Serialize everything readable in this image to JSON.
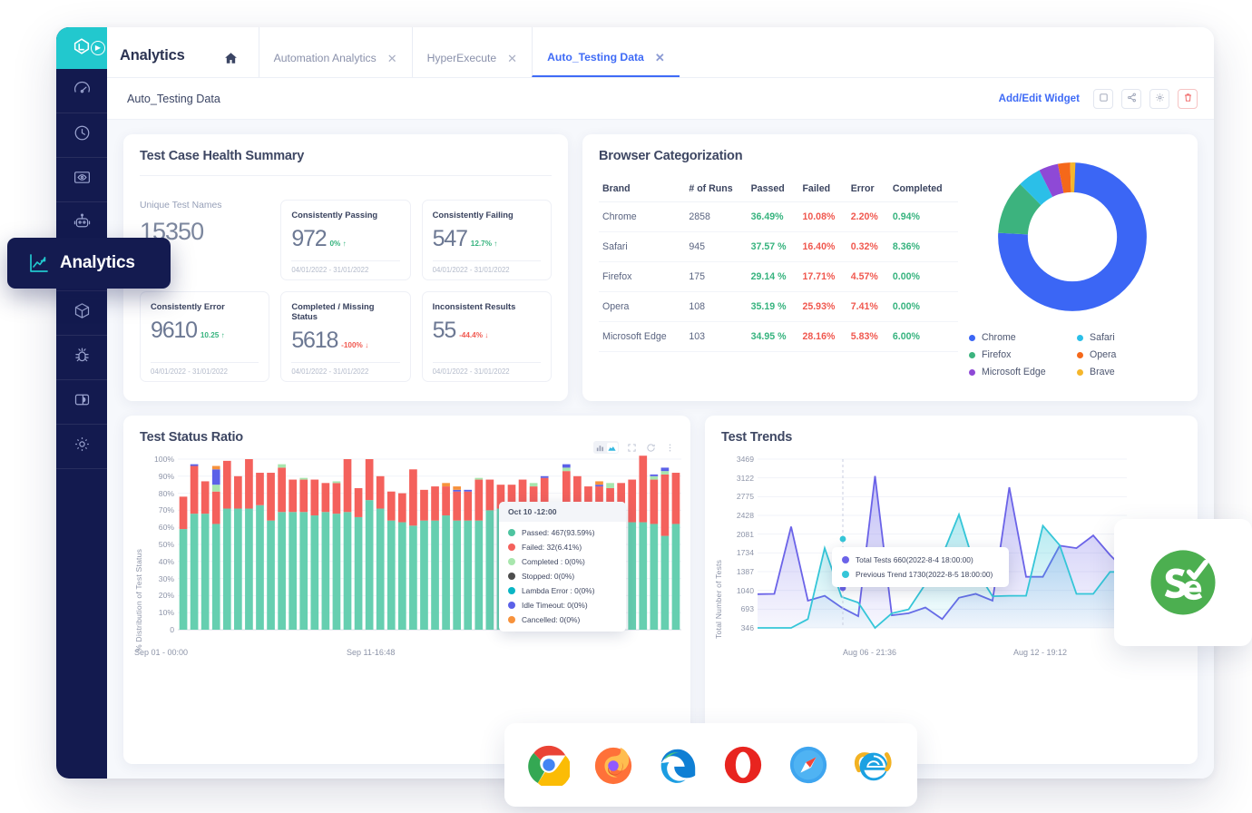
{
  "app": {
    "title": "Analytics",
    "home_icon": "home-icon",
    "logo_icon": "lambdatest-logo-icon",
    "expand_icon": "chevron-right-icon"
  },
  "sidebar": {
    "items": [
      {
        "name": "dashboard",
        "icon": "speedometer-icon"
      },
      {
        "name": "realtime",
        "icon": "clock-icon"
      },
      {
        "name": "screenshot",
        "icon": "monitor-eye-icon"
      },
      {
        "name": "automation",
        "icon": "robot-icon"
      },
      {
        "name": "analytics",
        "icon": "analytics-chart-icon"
      },
      {
        "name": "integrations",
        "icon": "box-icon"
      },
      {
        "name": "bugs",
        "icon": "bug-icon"
      },
      {
        "name": "docs",
        "icon": "book-contrast-icon"
      },
      {
        "name": "settings",
        "icon": "gear-icon"
      }
    ]
  },
  "tabs": [
    {
      "label": "Automation Analytics",
      "active": false,
      "close_icon": "close-icon"
    },
    {
      "label": "HyperExecute",
      "active": false,
      "close_icon": "close-icon"
    },
    {
      "label": "Auto_Testing Data",
      "active": true,
      "close_icon": "close-icon"
    }
  ],
  "subbar": {
    "breadcrumb": "Auto_Testing Data",
    "add_edit_widget": "Add/Edit Widget",
    "buttons": [
      {
        "name": "widget-layout-button",
        "icon": "square-icon"
      },
      {
        "name": "share-button",
        "icon": "share-icon"
      },
      {
        "name": "settings-button",
        "icon": "gear-icon"
      },
      {
        "name": "delete-button",
        "icon": "trash-icon"
      }
    ]
  },
  "health": {
    "title": "Test Case Health Summary",
    "unique": {
      "label": "Unique Test Names",
      "value": "15350"
    },
    "cards": [
      {
        "name": "Consistently Passing",
        "value": "972",
        "delta": "0%",
        "dir": "up",
        "range": "04/01/2022 - 31/01/2022"
      },
      {
        "name": "Consistently Failing",
        "value": "547",
        "delta": "12.7%",
        "dir": "up",
        "range": "04/01/2022 - 31/01/2022"
      },
      {
        "name": "Consistently Error",
        "value": "9610",
        "delta": "10.25",
        "dir": "up",
        "range": "04/01/2022 - 31/01/2022"
      },
      {
        "name": "Completed / Missing Status",
        "value": "5618",
        "delta": "-100%",
        "dir": "down",
        "range": "04/01/2022 - 31/01/2022"
      },
      {
        "name": "Inconsistent Results",
        "value": "55",
        "delta": "-44.4%",
        "dir": "down",
        "range": "04/01/2022 - 31/01/2022"
      }
    ]
  },
  "browser": {
    "title": "Browser Categorization",
    "columns": [
      "Brand",
      "# of Runs",
      "Passed",
      "Failed",
      "Error",
      "Completed"
    ],
    "rows": [
      {
        "brand": "Chrome",
        "runs": "2858",
        "passed": "36.49%",
        "failed": "10.08%",
        "error": "2.20%",
        "completed": "0.94%"
      },
      {
        "brand": "Safari",
        "runs": "945",
        "passed": "37.57 %",
        "failed": "16.40%",
        "error": "0.32%",
        "completed": "8.36%"
      },
      {
        "brand": "Firefox",
        "runs": "175",
        "passed": "29.14 %",
        "failed": "17.71%",
        "error": "4.57%",
        "completed": "0.00%"
      },
      {
        "brand": "Opera",
        "runs": "108",
        "passed": "35.19 %",
        "failed": "25.93%",
        "error": "7.41%",
        "completed": "0.00%"
      },
      {
        "brand": "Microsoft Edge",
        "runs": "103",
        "passed": "34.95 %",
        "failed": "28.16%",
        "error": "5.83%",
        "completed": "6.00%"
      }
    ],
    "legend": [
      {
        "label": "Chrome",
        "color": "#3b66f5"
      },
      {
        "label": "Safari",
        "color": "#2bbfe8"
      },
      {
        "label": "Firefox",
        "color": "#3cb37e"
      },
      {
        "label": "Opera",
        "color": "#f5681a"
      },
      {
        "label": "Microsoft Edge",
        "color": "#8e49d6"
      },
      {
        "label": "Brave",
        "color": "#f5b62b"
      }
    ]
  },
  "ratio": {
    "title": "Test Status Ratio",
    "toolbar": [
      "bar-chart-icon",
      "area-chart-icon",
      "fullscreen-icon",
      "reset-icon",
      "menu-icon"
    ],
    "ylabel": "% Distribution of Test Status",
    "yticks": [
      "100%",
      "90%",
      "80%",
      "70%",
      "60%",
      "50%",
      "40%",
      "30%",
      "20%",
      "10%",
      "0"
    ],
    "xticks": [
      "Sep 01 - 00:00",
      "Sep 11-16:48"
    ],
    "tooltip": {
      "title": "Oct 10 -12:00",
      "rows": [
        {
          "label": "Passed: 467(93.59%)",
          "color": "#4ec4a0"
        },
        {
          "label": "Failed: 32(6.41%)",
          "color": "#f4615c"
        },
        {
          "label": "Completed : 0(0%)",
          "color": "#a8e6ad"
        },
        {
          "label": "Stopped: 0(0%)",
          "color": "#4d4d4d"
        },
        {
          "label": "Lambda Error : 0(0%)",
          "color": "#0ab5c4"
        },
        {
          "label": "Idle Timeout: 0(0%)",
          "color": "#5b61e8"
        },
        {
          "label": "Cancelled: 0(0%)",
          "color": "#f7923c"
        }
      ]
    }
  },
  "trends": {
    "title": "Test Trends",
    "ylabel": "Total Number of Tests",
    "yticks": [
      "3469",
      "3122",
      "2775",
      "2428",
      "2081",
      "1734",
      "1387",
      "1040",
      "693",
      "346"
    ],
    "xticks": [
      "Aug 06 - 21:36",
      "Aug 12 - 19:12"
    ],
    "tooltip": {
      "rows": [
        {
          "label": "Total Tests 660(2022-8-4 18:00:00)",
          "color": "#6b63e8"
        },
        {
          "label": "Previous Trend 1730(2022-8-5 18:00:00)",
          "color": "#35c6d8"
        }
      ]
    }
  },
  "overlays": {
    "analytics_callout": {
      "label": "Analytics",
      "icon": "analytics-chart-icon"
    },
    "browser_icons": [
      "chrome-icon",
      "firefox-icon",
      "edge-icon",
      "opera-icon",
      "safari-icon",
      "internet-explorer-icon"
    ],
    "selenium": "selenium-logo-icon"
  },
  "chart_data": [
    {
      "type": "bar",
      "title": "Test Status Ratio",
      "stacked": true,
      "xlabel": "",
      "ylabel": "% Distribution of Test Status",
      "ylim": [
        0,
        100
      ],
      "yticks": [
        0,
        10,
        20,
        30,
        40,
        50,
        60,
        70,
        80,
        90,
        100
      ],
      "x_range": [
        "Sep 01 - 00:00",
        "Sep 11-16:48"
      ],
      "grid": true,
      "series": [
        {
          "name": "Passed",
          "color": "#66cfb0",
          "values": [
            59,
            68,
            68,
            62,
            71,
            71,
            71,
            73,
            64,
            69,
            69,
            69,
            67,
            69,
            68,
            69,
            66,
            76,
            71,
            64,
            63,
            61,
            64,
            64,
            67,
            64,
            64,
            64,
            70,
            71,
            67,
            69,
            69,
            70,
            43,
            61,
            62,
            61,
            62,
            62,
            61,
            63,
            63,
            62,
            55,
            62
          ]
        },
        {
          "name": "Failed",
          "color": "#f4615c",
          "values": [
            19,
            28,
            19,
            19,
            28,
            19,
            29,
            19,
            28,
            26,
            19,
            19,
            21,
            17,
            18,
            31,
            17,
            24,
            19,
            17,
            17,
            33,
            18,
            20,
            17,
            17,
            17,
            24,
            18,
            14,
            18,
            19,
            15,
            19,
            17,
            32,
            28,
            23,
            22,
            21,
            25,
            25,
            39,
            26,
            36,
            30
          ]
        },
        {
          "name": "Completed",
          "color": "#a8e6ad",
          "values": [
            0,
            0,
            0,
            4,
            0,
            0,
            0,
            0,
            0,
            2,
            0,
            1,
            0,
            0,
            1,
            0,
            0,
            0,
            0,
            0,
            0,
            0,
            0,
            0,
            0,
            0,
            0,
            1,
            0,
            0,
            0,
            0,
            2,
            0,
            0,
            2,
            0,
            0,
            0,
            3,
            0,
            0,
            0,
            2,
            2,
            0
          ]
        },
        {
          "name": "Idle Timeout",
          "color": "#5b61e8",
          "values": [
            0,
            1,
            0,
            9,
            0,
            0,
            0,
            0,
            0,
            0,
            0,
            0,
            0,
            0,
            0,
            0,
            0,
            0,
            0,
            0,
            0,
            0,
            0,
            0,
            0,
            1,
            1,
            0,
            0,
            0,
            0,
            0,
            0,
            1,
            0,
            2,
            0,
            0,
            1,
            0,
            0,
            0,
            0,
            1,
            2,
            0
          ]
        },
        {
          "name": "Cancelled",
          "color": "#f7923c",
          "values": [
            0,
            0,
            0,
            2,
            0,
            0,
            0,
            0,
            0,
            0,
            0,
            0,
            0,
            0,
            0,
            0,
            0,
            0,
            0,
            0,
            0,
            0,
            0,
            0,
            2,
            2,
            0,
            0,
            0,
            0,
            0,
            0,
            0,
            0,
            0,
            0,
            0,
            0,
            2,
            0,
            0,
            0,
            0,
            0,
            0,
            0
          ]
        }
      ]
    },
    {
      "type": "area",
      "title": "Test Trends",
      "xlabel": "",
      "ylabel": "Total Number of Tests",
      "ylim": [
        0,
        3469
      ],
      "yticks": [
        346,
        693,
        1040,
        1387,
        1734,
        2081,
        2428,
        2775,
        3122,
        3469
      ],
      "x_range": [
        "Aug 06 - 21:36",
        "Aug 12 - 19:12"
      ],
      "grid": true,
      "series": [
        {
          "name": "Total Tests",
          "color": "#6b63e8",
          "values": [
            693,
            700,
            2081,
            560,
            660,
            420,
            240,
            3122,
            260,
            300,
            420,
            180,
            620,
            700,
            560,
            2890,
            1050,
            1050,
            1690,
            1640,
            1900,
            1500,
            1150
          ]
        },
        {
          "name": "Previous Trend",
          "color": "#35c6d8",
          "values": [
            0,
            0,
            0,
            180,
            1640,
            640,
            520,
            0,
            300,
            380,
            900,
            1480,
            2330,
            1200,
            650,
            660,
            660,
            2100,
            1700,
            700,
            700,
            1150,
            1150
          ]
        }
      ]
    },
    {
      "type": "pie",
      "title": "Browser Categorization",
      "labels": [
        "Chrome",
        "Firefox",
        "Safari",
        "Microsoft Edge",
        "Opera",
        "Brave"
      ],
      "values": [
        2858,
        175,
        945,
        103,
        108,
        40
      ],
      "colors": [
        "#3b66f5",
        "#3cb37e",
        "#2bbfe8",
        "#8e49d6",
        "#f5681a",
        "#f5b62b"
      ],
      "donut": true,
      "legend_position": "bottom"
    }
  ]
}
